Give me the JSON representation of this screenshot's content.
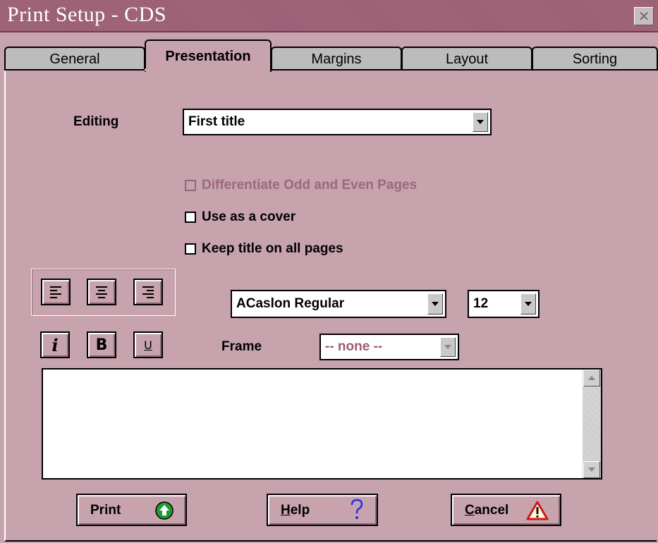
{
  "window": {
    "title": "Print Setup - CDS",
    "close_glyph": "✕"
  },
  "tabs": [
    {
      "label": "General",
      "active": false
    },
    {
      "label": "Presentation",
      "active": true
    },
    {
      "label": "Margins",
      "active": false
    },
    {
      "label": "Layout",
      "active": false
    },
    {
      "label": "Sorting",
      "active": false
    }
  ],
  "editing": {
    "label": "Editing",
    "value": "First title"
  },
  "options": [
    {
      "label": "Differentiate Odd and Even Pages",
      "checked": false,
      "enabled": false
    },
    {
      "label": "Use as a cover",
      "checked": false,
      "enabled": true
    },
    {
      "label": "Keep title on all pages",
      "checked": false,
      "enabled": true
    }
  ],
  "alignment": {
    "icons": [
      "align-left-icon",
      "align-center-icon",
      "align-right-icon"
    ]
  },
  "format": {
    "italic": "i",
    "bold": "B",
    "underline": "U"
  },
  "font": {
    "name": "ACaslon Regular",
    "size": "12"
  },
  "frame": {
    "label": "Frame",
    "value": "-- none --",
    "enabled": false
  },
  "text_area": {
    "value": ""
  },
  "buttons": {
    "print": {
      "label": "Print",
      "icon": "green-up-arrow-icon"
    },
    "help": {
      "label": "Help",
      "accel": "H",
      "rest": "elp",
      "icon": "question-mark-icon"
    },
    "cancel": {
      "label": "Cancel",
      "accel": "C",
      "rest": "ancel",
      "icon": "warning-triangle-icon"
    }
  },
  "colors": {
    "background": "#c7a3ad",
    "titlebar": "#9a5d73",
    "disabled_text": "#9a6a7b"
  }
}
